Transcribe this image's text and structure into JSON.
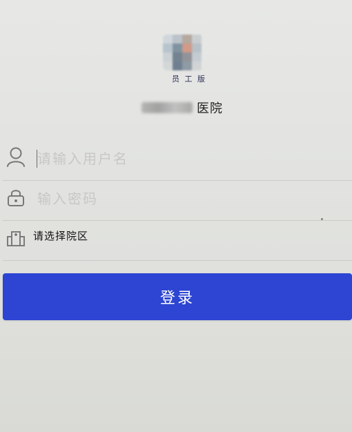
{
  "app": {
    "logo_subtitle": "员 工 版",
    "hospital_name": "医院"
  },
  "login_form": {
    "username_placeholder": "请输入用户名",
    "password_placeholder": "输入密码",
    "campus_select_label": "请选择院区",
    "login_button_label": "登录"
  },
  "colors": {
    "primary_button": "#2d45d2",
    "placeholder_text": "#c7c8c6",
    "divider": "#c9cbc6"
  },
  "icons": {
    "username_icon": "user-icon",
    "password_icon": "lock-icon",
    "campus_icon": "building-icon"
  }
}
